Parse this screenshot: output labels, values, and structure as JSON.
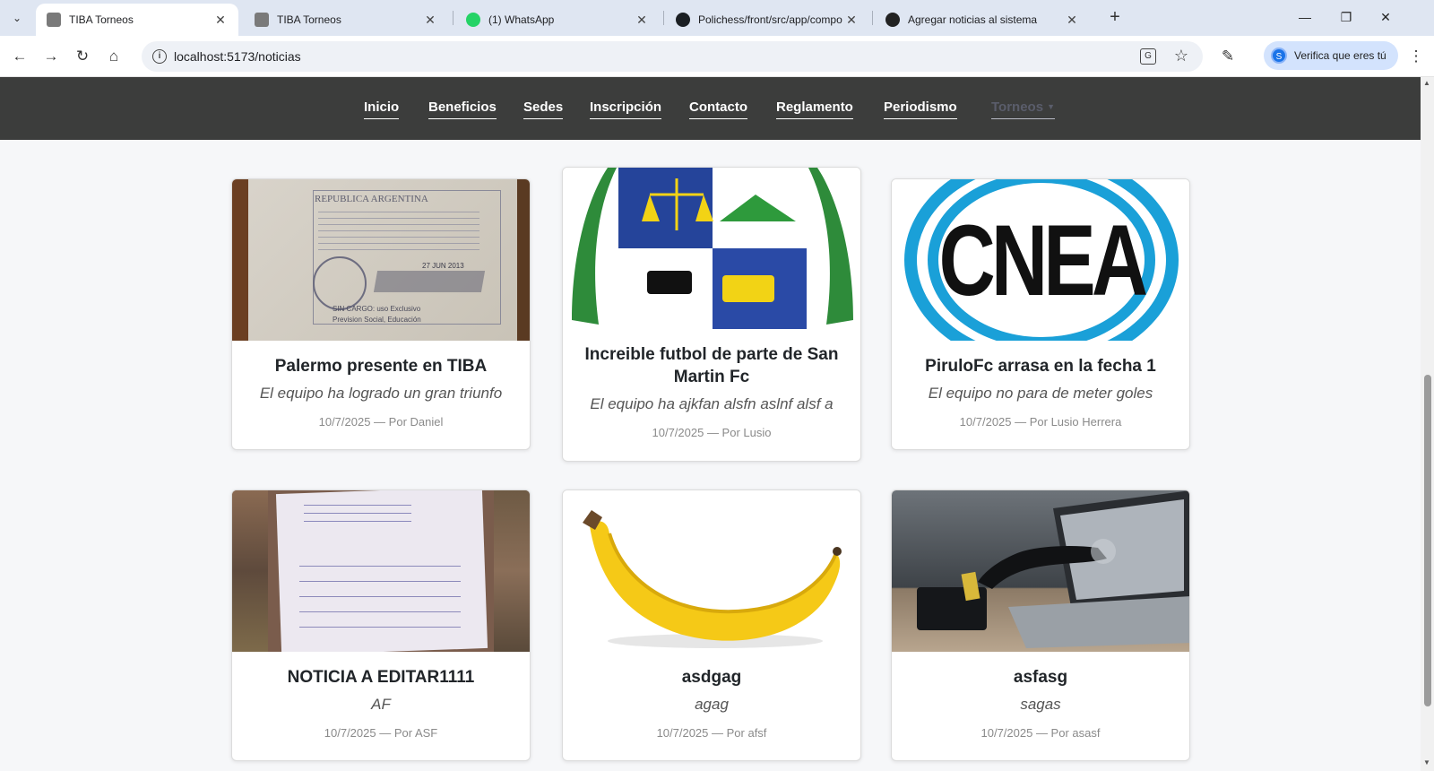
{
  "browser": {
    "tabs": [
      {
        "title": "TIBA Torneos",
        "active": true,
        "icon": "site-favicon"
      },
      {
        "title": "TIBA Torneos",
        "active": false,
        "icon": "site-favicon"
      },
      {
        "title": "(1) WhatsApp",
        "active": false,
        "icon": "whatsapp-icon"
      },
      {
        "title": "Polichess/front/src/app/compo",
        "active": false,
        "icon": "github-icon"
      },
      {
        "title": "Agregar noticias al sistema",
        "active": false,
        "icon": "openai-icon"
      }
    ],
    "url": "localhost:5173/noticias",
    "profile_label": "Verifica que eres tú",
    "profile_initial": "S"
  },
  "nav": {
    "items": [
      "Inicio",
      "Beneficios",
      "Sedes",
      "Inscripción",
      "Contacto",
      "Reglamento",
      "Periodismo",
      "Torneos"
    ]
  },
  "news": [
    {
      "title": "Palermo presente en TIBA",
      "summary": "El equipo ha logrado un gran triunfo",
      "meta": "10/7/2025 — Por Daniel",
      "image": "stamped-document"
    },
    {
      "title": "Increible futbol de parte de San Martin Fc",
      "summary": "El equipo ha ajkfan alsfn aslnf alsf a",
      "meta": "10/7/2025 — Por Lusio",
      "image": "coat-of-arms"
    },
    {
      "title": "PiruloFc arrasa en la fecha 1",
      "summary": "El equipo no para de meter goles",
      "meta": "10/7/2025 — Por Lusio Herrera",
      "image": "cnea-logo"
    },
    {
      "title": "NOTICIA A EDITAR1111",
      "summary": "AF",
      "meta": "10/7/2025 — Por ASF",
      "image": "handwritten-note"
    },
    {
      "title": "asdgag",
      "summary": "agag",
      "meta": "10/7/2025 — Por afsf",
      "image": "banana"
    },
    {
      "title": "asfasg",
      "summary": "sagas",
      "meta": "10/7/2025 — Por asasf",
      "image": "laptop-theft"
    }
  ],
  "image_text": {
    "cnea_logo": "CNEA",
    "document_lines": [
      "REPUBLICA ARGENTINA",
      "27 JUN 2013",
      "SIN CARGO: uso Exclusivo",
      "Prevision Social, Educación"
    ]
  },
  "colors": {
    "nav_bg": "#3c3d3c",
    "page_bg": "#f6f7f9",
    "tab_strip": "#dfe6f2"
  }
}
